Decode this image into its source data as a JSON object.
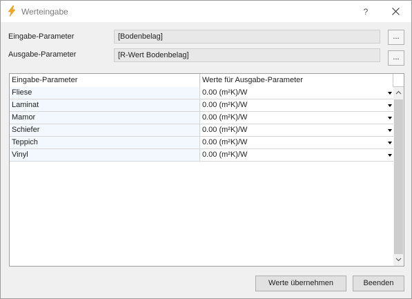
{
  "window": {
    "title": "Werteingabe",
    "help_label": "?"
  },
  "params": {
    "input_label": "Eingabe-Parameter",
    "input_value": "[Bodenbelag]",
    "output_label": "Ausgabe-Parameter",
    "output_value": "[R-Wert Bodenbelag]",
    "browse_label": "..."
  },
  "grid": {
    "columns": [
      "Eingabe-Parameter",
      "Werte für Ausgabe-Parameter"
    ],
    "rows": [
      {
        "input": "Fliese",
        "value": "0.00 (m²K)/W"
      },
      {
        "input": "Laminat",
        "value": "0.00 (m²K)/W"
      },
      {
        "input": "Mamor",
        "value": "0.00 (m²K)/W"
      },
      {
        "input": "Schiefer",
        "value": "0.00 (m²K)/W"
      },
      {
        "input": "Teppich",
        "value": "0.00 (m²K)/W"
      },
      {
        "input": "Vinyl",
        "value": "0.00 (m²K)/W"
      }
    ]
  },
  "buttons": {
    "apply": "Werte übernehmen",
    "quit": "Beenden"
  },
  "colors": {
    "accent_icon": "#f5a623",
    "input_column_bg": "#f2f8fd"
  }
}
